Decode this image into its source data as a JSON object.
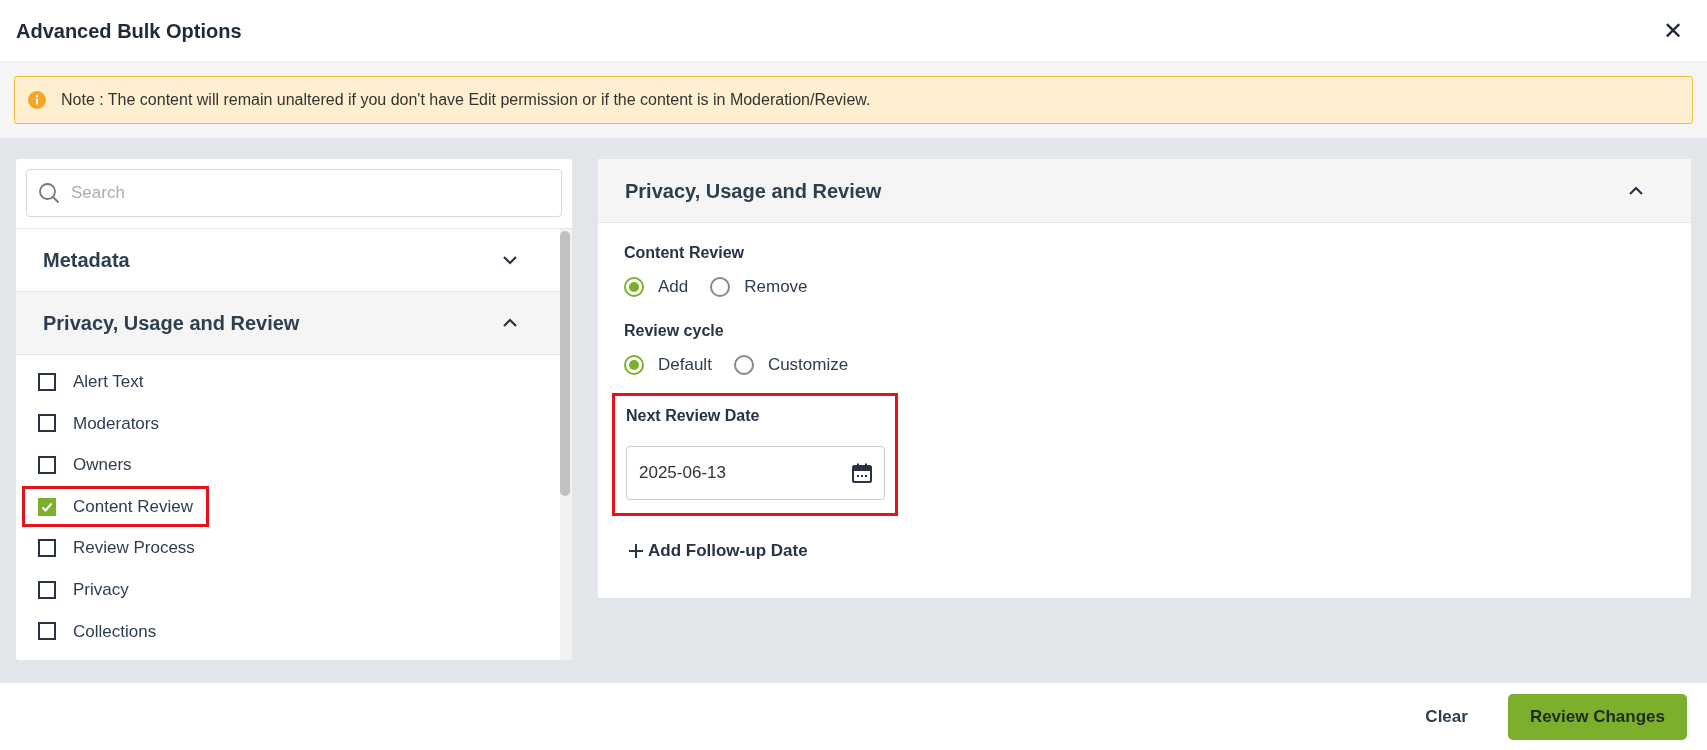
{
  "dialog": {
    "title": "Advanced Bulk Options",
    "close_label": "✕"
  },
  "note": {
    "text": "Note : The content will remain unaltered if you don't have Edit permission or if the content is in Moderation/Review."
  },
  "search": {
    "placeholder": "Search"
  },
  "sections": [
    {
      "title": "Metadata",
      "expanded": false
    },
    {
      "title": "Privacy, Usage and Review",
      "expanded": true,
      "items": [
        {
          "label": "Alert Text",
          "checked": false,
          "highlighted": false
        },
        {
          "label": "Moderators",
          "checked": false,
          "highlighted": false
        },
        {
          "label": "Owners",
          "checked": false,
          "highlighted": false
        },
        {
          "label": "Content Review",
          "checked": true,
          "highlighted": true
        },
        {
          "label": "Review Process",
          "checked": false,
          "highlighted": false
        },
        {
          "label": "Privacy",
          "checked": false,
          "highlighted": false
        },
        {
          "label": "Collections",
          "checked": false,
          "highlighted": false
        }
      ]
    }
  ],
  "detail": {
    "title": "Privacy, Usage and Review",
    "expanded": true,
    "groups": [
      {
        "label": "Content Review",
        "options": [
          {
            "label": "Add",
            "selected": true
          },
          {
            "label": "Remove",
            "selected": false
          }
        ]
      },
      {
        "label": "Review cycle",
        "options": [
          {
            "label": "Default",
            "selected": true
          },
          {
            "label": "Customize",
            "selected": false
          }
        ]
      }
    ],
    "date_field": {
      "label": "Next Review Date",
      "value": "2025-06-13",
      "highlighted": true
    },
    "add_link": {
      "label": "Add Follow-up Date"
    }
  },
  "footer": {
    "buttons": [
      {
        "kind": "secondary",
        "label": "Clear"
      },
      {
        "kind": "primary",
        "label": "Review Changes"
      }
    ]
  }
}
